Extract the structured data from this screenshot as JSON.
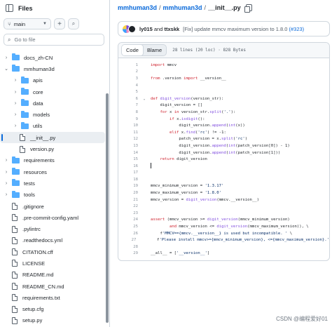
{
  "left_panel": {
    "title": "Files",
    "branch": "main",
    "search_placeholder": "Go to file",
    "tree": [
      {
        "label": "docs_zh-CN",
        "type": "folder",
        "expanded": false,
        "depth": 0
      },
      {
        "label": "mmhuman3d",
        "type": "folder",
        "expanded": true,
        "depth": 0
      },
      {
        "label": "apis",
        "type": "folder",
        "expanded": false,
        "depth": 1
      },
      {
        "label": "core",
        "type": "folder",
        "expanded": false,
        "depth": 1
      },
      {
        "label": "data",
        "type": "folder",
        "expanded": false,
        "depth": 1
      },
      {
        "label": "models",
        "type": "folder",
        "expanded": false,
        "depth": 1
      },
      {
        "label": "utils",
        "type": "folder",
        "expanded": false,
        "depth": 1
      },
      {
        "label": "__init__.py",
        "type": "file",
        "selected": true,
        "depth": 1
      },
      {
        "label": "version.py",
        "type": "file",
        "depth": 1
      },
      {
        "label": "requirements",
        "type": "folder",
        "expanded": false,
        "depth": 0
      },
      {
        "label": "resources",
        "type": "folder",
        "expanded": false,
        "depth": 0
      },
      {
        "label": "tests",
        "type": "folder",
        "expanded": false,
        "depth": 0
      },
      {
        "label": "tools",
        "type": "folder",
        "expanded": false,
        "depth": 0
      },
      {
        "label": ".gitignore",
        "type": "file",
        "depth": 0
      },
      {
        "label": ".pre-commit-config.yaml",
        "type": "file",
        "depth": 0
      },
      {
        "label": ".pylintrc",
        "type": "file",
        "depth": 0
      },
      {
        "label": ".readthedocs.yml",
        "type": "file",
        "depth": 0
      },
      {
        "label": "CITATION.cff",
        "type": "file",
        "depth": 0
      },
      {
        "label": "LICENSE",
        "type": "file",
        "depth": 0
      },
      {
        "label": "README.md",
        "type": "file",
        "depth": 0
      },
      {
        "label": "README_CN.md",
        "type": "file",
        "depth": 0
      },
      {
        "label": "requirements.txt",
        "type": "file",
        "depth": 0
      },
      {
        "label": "setup.cfg",
        "type": "file",
        "depth": 0
      },
      {
        "label": "setup.py",
        "type": "file",
        "depth": 0
      }
    ]
  },
  "breadcrumb": {
    "repo": "mmhuman3d",
    "folder": "mmhuman3d",
    "file": "__init__.py",
    "sep": "/"
  },
  "commit": {
    "authors": "ly015",
    "and": "and",
    "authors2": "ttxskk",
    "message": "[Fix] update mmcv maximum version to 1.8.0",
    "pr": "(#323)"
  },
  "code_view": {
    "tab_code": "Code",
    "tab_blame": "Blame",
    "meta": "28 lines (20 loc) · 828 Bytes",
    "lines": [
      {
        "n": "1",
        "t": "import mmcv"
      },
      {
        "n": "2",
        "t": ""
      },
      {
        "n": "3",
        "t": "from .version import __version__"
      },
      {
        "n": "4",
        "t": ""
      },
      {
        "n": "5",
        "t": ""
      },
      {
        "n": "6",
        "t": "def digit_version(version_str):"
      },
      {
        "n": "7",
        "t": "    digit_version = []"
      },
      {
        "n": "8",
        "t": "    for x in version_str.split('.'):"
      },
      {
        "n": "9",
        "t": "        if x.isdigit():"
      },
      {
        "n": "10",
        "t": "            digit_version.append(int(x))"
      },
      {
        "n": "11",
        "t": "        elif x.find('rc') != -1:"
      },
      {
        "n": "12",
        "t": "            patch_version = x.split('rc')"
      },
      {
        "n": "13",
        "t": "            digit_version.append(int(patch_version[0]) - 1)"
      },
      {
        "n": "14",
        "t": "            digit_version.append(int(patch_version[1]))"
      },
      {
        "n": "15",
        "t": "    return digit_version"
      },
      {
        "n": "16",
        "t": ""
      },
      {
        "n": "17",
        "t": ""
      },
      {
        "n": "18",
        "t": ""
      },
      {
        "n": "19",
        "t": "mmcv_minimum_version = '1.3.17'"
      },
      {
        "n": "20",
        "t": "mmcv_maximum_version = '1.8.0'"
      },
      {
        "n": "21",
        "t": "mmcv_version = digit_version(mmcv.__version__)"
      },
      {
        "n": "22",
        "t": ""
      },
      {
        "n": "23",
        "t": ""
      },
      {
        "n": "24",
        "t": "assert (mmcv_version >= digit_version(mmcv_minimum_version)"
      },
      {
        "n": "25",
        "t": "        and mmcv_version <= digit_version(mmcv_maximum_version)), \\"
      },
      {
        "n": "26",
        "t": "    f'MMCV=={mmcv.__version__} is used but incompatible. ' \\"
      },
      {
        "n": "27",
        "t": "    f'Please install mmcv>={mmcv_minimum_version}, <={mmcv_maximum_version}.'"
      },
      {
        "n": "28",
        "t": ""
      },
      {
        "n": "29",
        "t": "__all__ = ['__version__']"
      }
    ]
  },
  "watermark": "CSDN @编程爱好01",
  "colors": {
    "accent": "#0969da",
    "keyword": "#cf222e",
    "function": "#8250df",
    "string": "#0a3069",
    "folder": "#54aeff"
  }
}
